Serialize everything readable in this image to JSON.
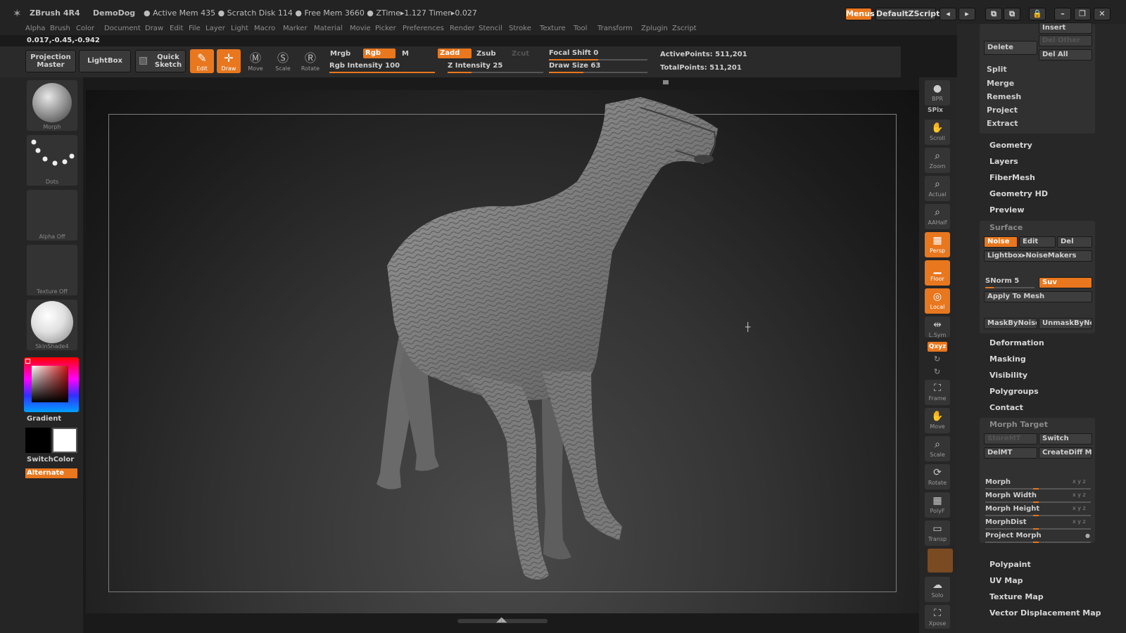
{
  "app": {
    "name": "ZBrush 4R4",
    "document": "DemoDog",
    "stats": "● Active Mem 435 ● Scratch Disk 114 ● Free Mem 3660 ● ZTime▸1.127 Timer▸0.027",
    "menus_button": "Menus",
    "script_button": "DefaultZScript",
    "coords": "0.017,-0.45,-0.942"
  },
  "menubar": [
    "Alpha",
    "Brush",
    "Color",
    "Document",
    "Draw",
    "Edit",
    "File",
    "Layer",
    "Light",
    "Macro",
    "Marker",
    "Material",
    "Movie",
    "Picker",
    "Preferences",
    "Render",
    "Stencil",
    "Stroke",
    "Texture",
    "Tool",
    "Transform",
    "Zplugin",
    "Zscript"
  ],
  "toolbar": {
    "projection_master": "Projection Master",
    "lightbox": "LightBox",
    "quick_sketch": "Quick Sketch",
    "edit": "Edit",
    "draw": "Draw",
    "move": "Move",
    "scale": "Scale",
    "rotate": "Rotate",
    "mrgb": "Mrgb",
    "rgb": "Rgb",
    "m": "M",
    "rgb_intensity": "Rgb Intensity 100",
    "zadd": "Zadd",
    "zsub": "Zsub",
    "zcut": "Zcut",
    "z_intensity": "Z Intensity 25",
    "focal_shift": "Focal Shift 0",
    "draw_size": "Draw Size 63",
    "active_points": "ActivePoints: 511,201",
    "total_points": "TotalPoints: 511,201",
    "rgb_intensity_level": 1.0,
    "z_intensity_level": 0.25,
    "focal_shift_level": 0.5,
    "draw_size_level": 0.35
  },
  "leftshelf": {
    "brush": "Morph",
    "stroke": "Dots",
    "alpha": "Alpha Off",
    "texture": "Texture Off",
    "material": "SkinShade4",
    "gradient": "Gradient",
    "switch_color": "SwitchColor",
    "alternate": "Alternate"
  },
  "rightcol": {
    "bpr": "BPR",
    "spix": "SPix",
    "scroll": "Scroll",
    "zoom": "Zoom",
    "actual": "Actual",
    "aahalf": "AAHalf",
    "persp": "Persp",
    "floor": "Floor",
    "local": "Local",
    "lsym": "L.Sym",
    "xyz": "Qxyz",
    "frame": "Frame",
    "move": "Move",
    "scale": "Scale",
    "rotate": "Rotate",
    "polyf": "PolyF",
    "transp": "Transp",
    "solo": "Solo",
    "xpose": "Xpose"
  },
  "tray": {
    "insert": "Insert",
    "del_other": "Del Other",
    "delete": "Delete",
    "del_all": "Del All",
    "split": "Split",
    "merge": "Merge",
    "remesh": "Remesh",
    "project": "Project",
    "extract": "Extract",
    "geometry": "Geometry",
    "layers": "Layers",
    "fibermesh": "FiberMesh",
    "geometry_hd": "Geometry HD",
    "preview": "Preview",
    "surface": "Surface",
    "noise": "Noise",
    "edit": "Edit",
    "del": "Del",
    "noisemakers": "Lightbox▸NoiseMakers",
    "snorm": "SNorm 5",
    "suv": "Suv",
    "apply_to_mesh": "Apply To Mesh",
    "maskbynoise": "MaskByNoise",
    "unmaskbynoise": "UnmaskByNo",
    "deformation": "Deformation",
    "masking": "Masking",
    "visibility": "Visibility",
    "polygroups": "Polygroups",
    "contact": "Contact",
    "morph_target": "Morph Target",
    "storemt": "StoreMT",
    "switch": "Switch",
    "delmt": "DelMT",
    "creatediff": "CreateDiff M",
    "morph": "Morph",
    "morph_width": "Morph Width",
    "morph_height": "Morph Height",
    "morphdist": "MorphDist",
    "project_morph": "Project Morph",
    "xyz_tag": "x y z",
    "polypaint": "Polypaint",
    "uv_map": "UV Map",
    "texture_map": "Texture Map",
    "vector_displacement_map": "Vector Displacement Map"
  },
  "colors": {
    "accent": "#e8771e",
    "background": "#1a1a1a",
    "panel": "#313131"
  }
}
